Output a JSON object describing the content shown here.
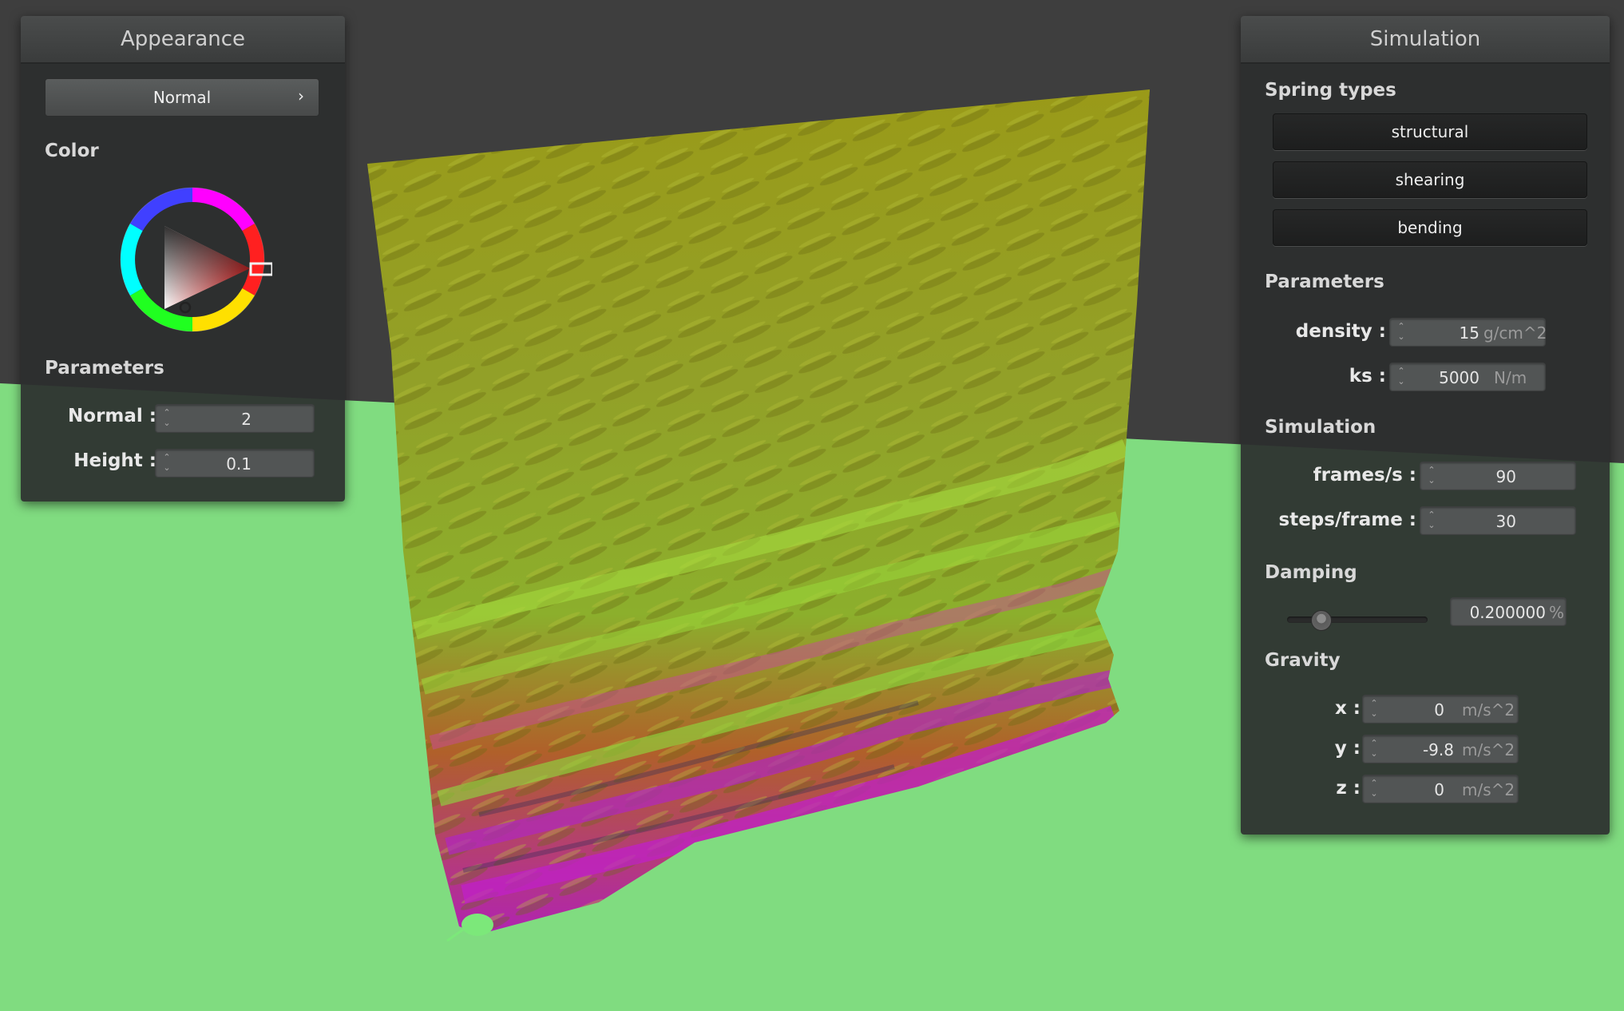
{
  "appearance_panel": {
    "title": "Appearance",
    "mode_dropdown": {
      "selected": "Normal",
      "chevron": "›"
    },
    "color_section_label": "Color",
    "color_wheel_icon": "color-wheel-icon",
    "parameters_label": "Parameters",
    "fields": [
      {
        "label": "Normal :",
        "value": "2"
      },
      {
        "label": "Height :",
        "value": "0.1"
      }
    ]
  },
  "simulation_panel": {
    "title": "Simulation",
    "spring_types_label": "Spring types",
    "spring_buttons": [
      "structural",
      "shearing",
      "bending"
    ],
    "parameters_label": "Parameters",
    "density": {
      "label": "density :",
      "value": "15",
      "unit": "g/cm^2"
    },
    "ks": {
      "label": "ks :",
      "value": "5000",
      "unit": "N/m"
    },
    "simulation_label": "Simulation",
    "frames_per_second": {
      "label": "frames/s :",
      "value": "90"
    },
    "steps_per_frame": {
      "label": "steps/frame :",
      "value": "30"
    },
    "damping_label": "Damping",
    "damping": {
      "value": "0.200000",
      "unit": "%",
      "slider_fraction": 0.2
    },
    "gravity_label": "Gravity",
    "gravity": [
      {
        "label": "x :",
        "value": "0",
        "unit": "m/s^2"
      },
      {
        "label": "y :",
        "value": "-9.8",
        "unit": "m/s^2"
      },
      {
        "label": "z :",
        "value": "0",
        "unit": "m/s^2"
      }
    ]
  },
  "scene": {
    "background_color": "#3e3e3e",
    "floor_color": "#80dc80"
  }
}
